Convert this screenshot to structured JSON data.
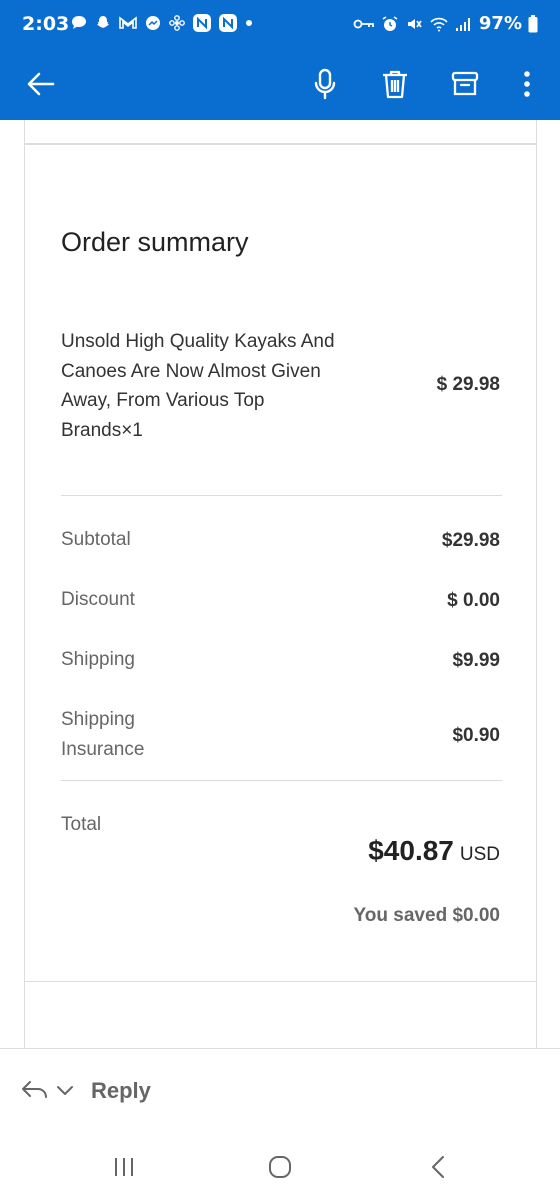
{
  "status_bar": {
    "time": "2:03",
    "battery": "97%"
  },
  "app_bar": {
    "icons": [
      "back-arrow-icon",
      "microphone-icon",
      "trash-icon",
      "archive-icon",
      "more-vertical-icon"
    ]
  },
  "order_summary": {
    "title": "Order summary",
    "item": {
      "name": "Unsold High Quality Kayaks And Canoes Are Now Almost Given Away, From Various Top Brands×1",
      "price": "$ 29.98"
    },
    "rows": [
      {
        "label": "Subtotal",
        "value": "$29.98"
      },
      {
        "label": "Discount",
        "value": "$ 0.00"
      },
      {
        "label": "Shipping",
        "value": "$9.99"
      },
      {
        "label": "Shipping Insurance",
        "value": "$0.90"
      }
    ],
    "total": {
      "label": "Total",
      "amount": "$40.87",
      "currency": "USD"
    },
    "saved": "You saved $0.00"
  },
  "reply_bar": {
    "label": "Reply"
  },
  "colors": {
    "accent": "#0a6ed1",
    "muted_text": "#666666",
    "divider": "#dddddd"
  }
}
